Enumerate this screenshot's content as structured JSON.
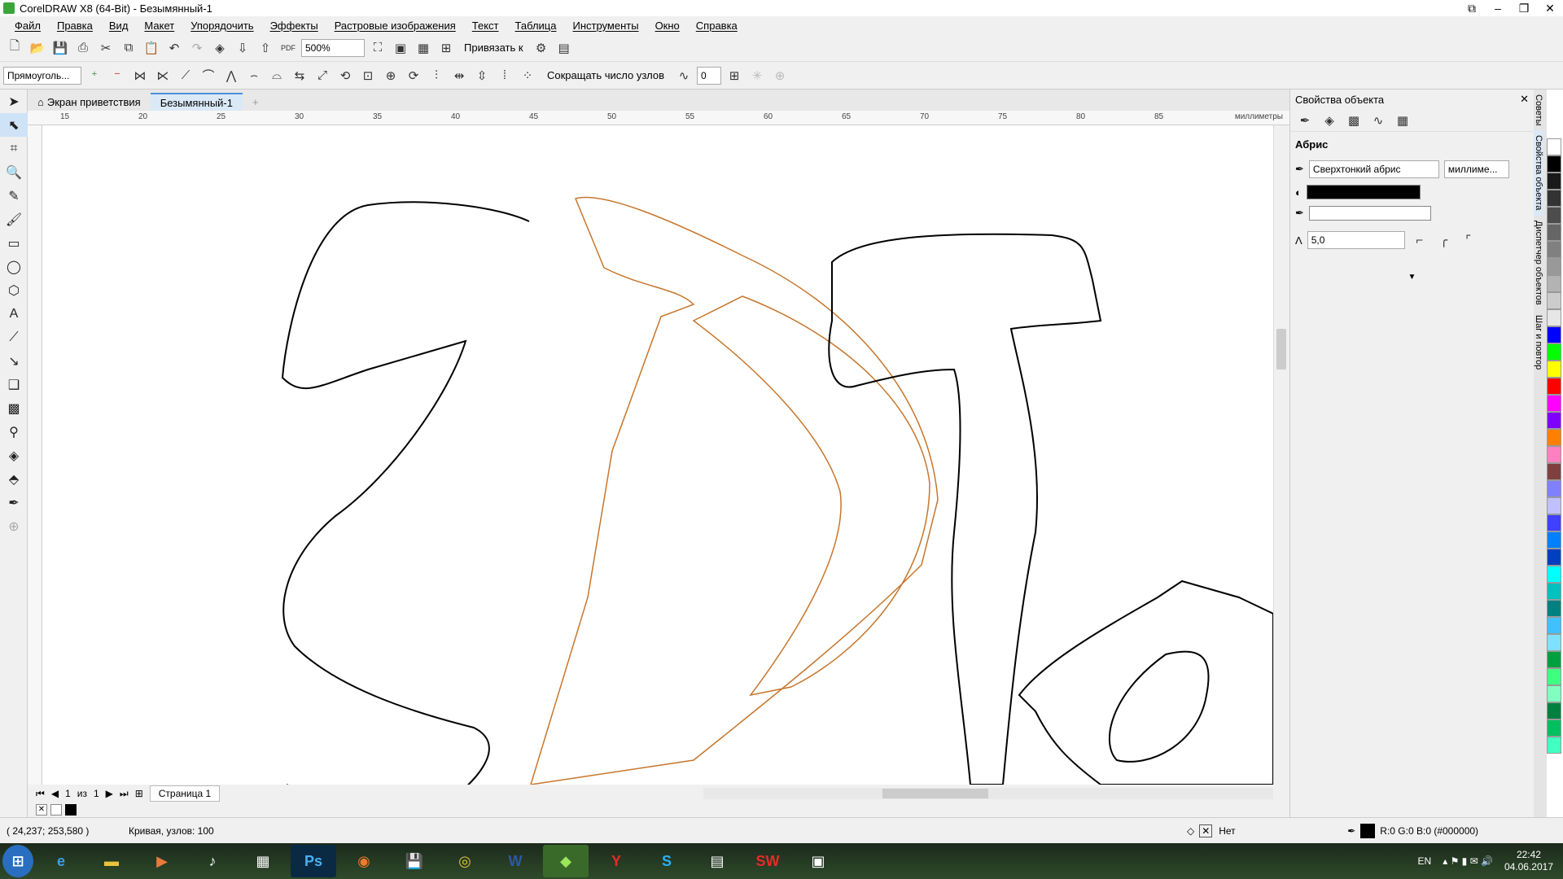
{
  "window": {
    "title": "CorelDRAW X8 (64-Bit) - Безымянный-1"
  },
  "menu": [
    "Файл",
    "Правка",
    "Вид",
    "Макет",
    "Упорядочить",
    "Эффекты",
    "Растровые изображения",
    "Текст",
    "Таблица",
    "Инструменты",
    "Окно",
    "Справка"
  ],
  "toolbar": {
    "zoom": "500%",
    "snap_label": "Привязать к"
  },
  "propbar": {
    "shape_combo": "Прямоуголь...",
    "reduce_nodes_label": "Сокращать число узлов",
    "smoothing_value": "0"
  },
  "tabs": {
    "welcome": "Экран приветствия",
    "doc": "Безымянный-1"
  },
  "ruler": {
    "ticks": [
      "15",
      "20",
      "25",
      "30",
      "35",
      "40",
      "45",
      "50",
      "55",
      "60",
      "65",
      "70",
      "75",
      "80",
      "85"
    ],
    "units": "миллиметры"
  },
  "page_nav": {
    "current": "1",
    "of_label": "из",
    "total": "1",
    "page_tab": "Страница 1"
  },
  "status": {
    "coords": "( 24,237; 253,580 )",
    "object_info": "Кривая, узлов: 100",
    "fill_label": "Нет",
    "outline_color": "R:0 G:0 B:0 (#000000)"
  },
  "docker": {
    "title": "Свойства объекта",
    "section": "Абрис",
    "outline_width": "Сверхтонкий абрис",
    "units": "миллиме...",
    "miter_value": "5,0",
    "side_tabs": [
      "Советы",
      "Свойства объекта",
      "Диспетчер объектов",
      "Шаг и повтор"
    ]
  },
  "taskbar": {
    "lang": "EN",
    "time": "22:42",
    "date": "04.06.2017"
  },
  "palette_colors": [
    "#ffffff",
    "#000000",
    "#1a1a1a",
    "#333333",
    "#4d4d4d",
    "#666666",
    "#808080",
    "#999999",
    "#b3b3b3",
    "#cccccc",
    "#e6e6e6",
    "#0000ff",
    "#00ff00",
    "#ffff00",
    "#ff0000",
    "#ff00ff",
    "#8000ff",
    "#ff8000",
    "#ff80c0",
    "#804040",
    "#8080ff",
    "#c0c0ff",
    "#4040ff",
    "#0080ff",
    "#0040c0",
    "#00ffff",
    "#00c0c0",
    "#008080",
    "#40c0ff",
    "#80e0ff",
    "#00a040",
    "#40ff80",
    "#80ffc0",
    "#008040",
    "#00c060",
    "#40ffc0"
  ]
}
